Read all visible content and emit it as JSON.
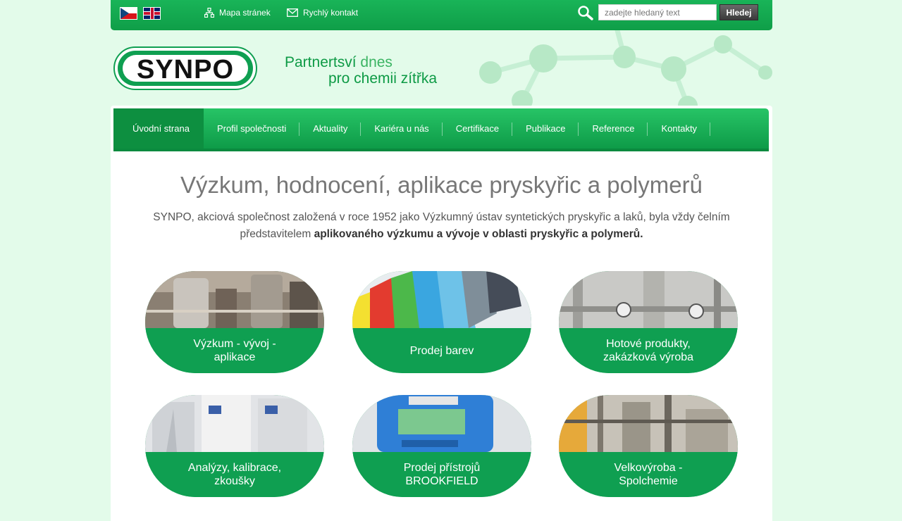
{
  "topbar": {
    "map_label": "Mapa stránek",
    "contact_label": "Rychlý kontakt",
    "search_placeholder": "zadejte hledaný text",
    "search_button": "Hledej"
  },
  "header": {
    "logo_text": "SYNPO",
    "tagline_1a": "Partnertsví",
    "tagline_1b": "dnes",
    "tagline_2": "pro chemii zítřka"
  },
  "nav": {
    "items": [
      {
        "label": "Úvodní strana"
      },
      {
        "label": "Profil společnosti"
      },
      {
        "label": "Aktuality"
      },
      {
        "label": "Kariéra u nás"
      },
      {
        "label": "Certifikace"
      },
      {
        "label": "Publikace"
      },
      {
        "label": "Reference"
      },
      {
        "label": "Kontakty"
      }
    ]
  },
  "main": {
    "headline": "Výzkum, hodnocení, aplikace pryskyřic a polymerů",
    "intro_text": "SYNPO, akciová společnost založená v roce 1952 jako Výzkumný ústav syntetických pryskyřic a laků, byla vždy čelním představitelem",
    "intro_bold": "aplikovaného výzkumu a vývoje v oblasti pryskyřic a polymerů."
  },
  "cards": [
    {
      "label": "Výzkum - vývoj -\naplikace"
    },
    {
      "label": "Prodej barev"
    },
    {
      "label": "Hotové produkty,\nzakázková výroba"
    },
    {
      "label": "Analýzy, kalibrace,\nzkoušky"
    },
    {
      "label": "Prodej přístrojů\nBROOKFIELD"
    },
    {
      "label": "Velkovýroba -\nSpolchemie"
    }
  ],
  "colors": {
    "brand_green": "#0f9f51",
    "background": "#e3fbea",
    "search_button": "#4a4a4a"
  }
}
